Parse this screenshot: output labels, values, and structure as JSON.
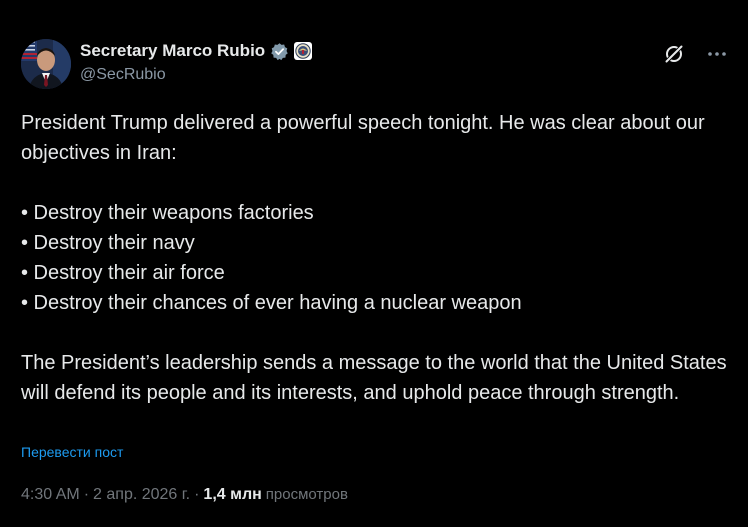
{
  "author": {
    "display_name": "Secretary Marco Rubio",
    "handle": "@SecRubio",
    "icons": {
      "verified": "verified-badge-icon",
      "affiliation": "state-department-seal-icon"
    }
  },
  "actions": {
    "grok": "grok-icon",
    "more": "more-icon"
  },
  "tweet": {
    "intro": "President Trump delivered a powerful speech tonight. He was clear about our objectives in Iran:",
    "bullets": [
      "• Destroy their weapons factories",
      "• Destroy their navy",
      "• Destroy their air force",
      "• Destroy their chances of ever having a nuclear weapon"
    ],
    "closing": "The President’s leadership sends a message to the world that the United States will defend its people and its interests, and uphold peace through strength."
  },
  "translate_label": "Перевести пост",
  "meta": {
    "time": "4:30 AM",
    "date": "2 апр. 2026 г.",
    "separator": "·",
    "views_count": "1,4 млн",
    "views_label": "просмотров"
  },
  "colors": {
    "background": "#000000",
    "text": "#e7e9ea",
    "secondary": "#71767b",
    "link": "#1d9bf0",
    "verified": "#829aab"
  }
}
